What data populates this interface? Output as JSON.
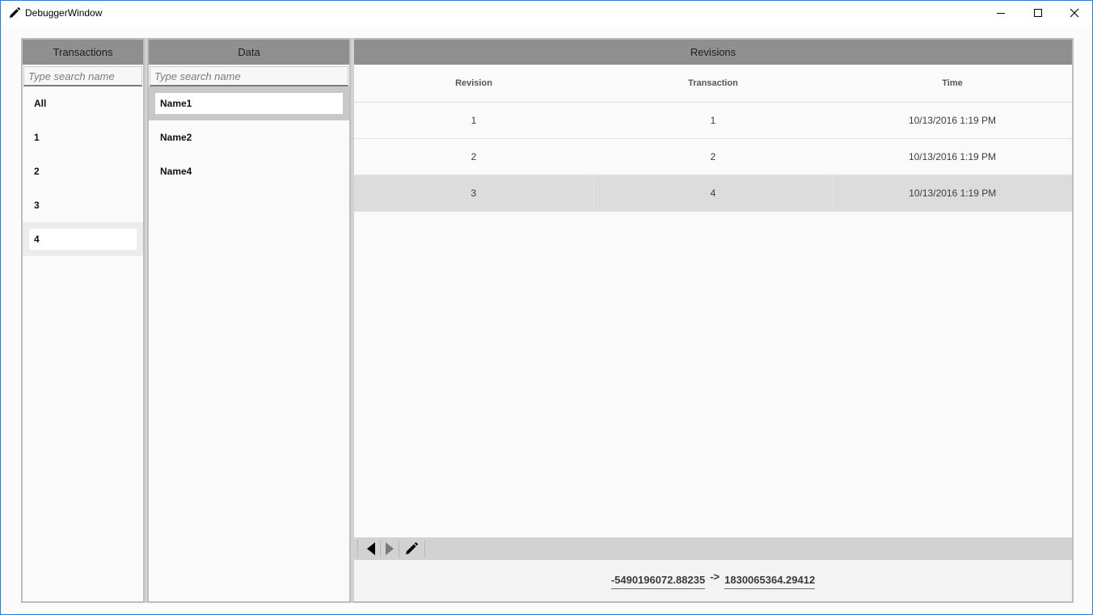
{
  "window": {
    "title": "DebuggerWindow"
  },
  "transactions": {
    "header": "Transactions",
    "search_placeholder": "Type search name",
    "items": [
      "All",
      "1",
      "2",
      "3",
      "4"
    ],
    "selected_index": 4
  },
  "data": {
    "header": "Data",
    "search_placeholder": "Type search name",
    "items": [
      "Name1",
      "Name2",
      "Name4"
    ],
    "selected_index": 0
  },
  "revisions": {
    "header": "Revisions",
    "columns": [
      "Revision",
      "Transaction",
      "Time"
    ],
    "rows": [
      {
        "revision": "1",
        "transaction": "1",
        "time": "10/13/2016 1:19 PM"
      },
      {
        "revision": "2",
        "transaction": "2",
        "time": "10/13/2016 1:19 PM"
      },
      {
        "revision": "3",
        "transaction": "4",
        "time": "10/13/2016 1:19 PM"
      }
    ],
    "selected_row": 2
  },
  "value_change": {
    "from": "-5490196072.88235",
    "arrow": "->",
    "to": "1830065364.29412"
  }
}
